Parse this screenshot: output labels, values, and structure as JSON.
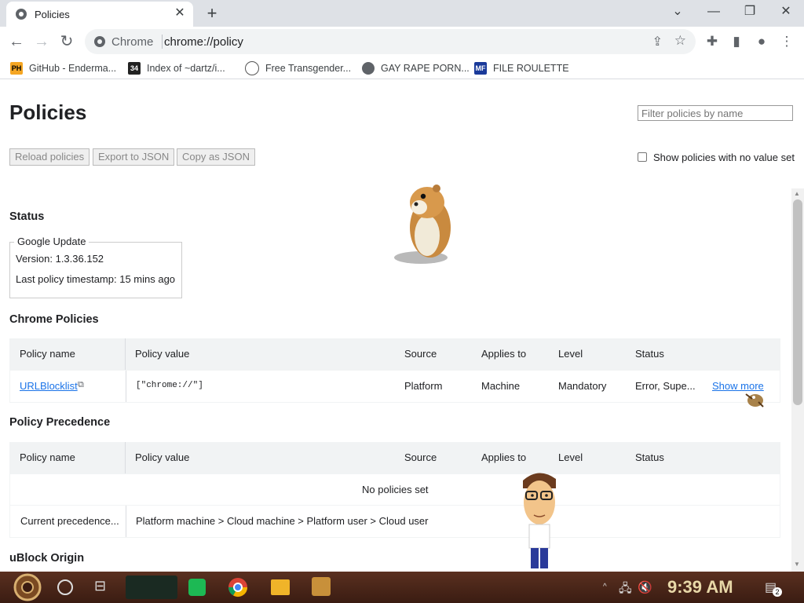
{
  "browser": {
    "tab_title": "Policies",
    "omnibox_chip": "Chrome",
    "url": "chrome://policy"
  },
  "bookmarks": [
    {
      "label": "GitHub - Enderma...",
      "icon_text": "PH",
      "icon_color": "#f5a623"
    },
    {
      "label": "Index of ~dartz/i...",
      "icon_text": "34",
      "icon_color": "#222222"
    },
    {
      "label": "Free Transgender...",
      "icon_text": "",
      "icon_color": "#555555"
    },
    {
      "label": "GAY RAPE PORN...",
      "icon_text": "",
      "icon_color": "#5f6368"
    },
    {
      "label": "FILE ROULETTE",
      "icon_text": "MF",
      "icon_color": "#1a3a9a"
    }
  ],
  "page": {
    "title": "Policies",
    "filter_placeholder": "Filter policies by name",
    "buttons": {
      "reload": "Reload policies",
      "export": "Export to JSON",
      "copy": "Copy as JSON"
    },
    "show_no_value_label": "Show policies with no value set",
    "status": {
      "heading": "Status",
      "legend": "Google Update",
      "version": "Version: 1.3.36.152",
      "timestamp": "Last policy timestamp: 15 mins ago"
    },
    "chrome_policies": {
      "heading": "Chrome Policies",
      "columns": [
        "Policy name",
        "Policy value",
        "Source",
        "Applies to",
        "Level",
        "Status"
      ],
      "rows": [
        {
          "name": "URLBlocklist",
          "value": "[\"chrome://\"]",
          "source": "Platform",
          "applies_to": "Machine",
          "level": "Mandatory",
          "status": "Error, Supe...",
          "action": "Show more"
        }
      ]
    },
    "precedence": {
      "heading": "Policy Precedence",
      "columns": [
        "Policy name",
        "Policy value",
        "Source",
        "Applies to",
        "Level",
        "Status"
      ],
      "empty": "No policies set",
      "current_label": "Current precedence...",
      "current_value": "Platform machine > Cloud machine > Platform user > Cloud user"
    },
    "next_heading": "uBlock Origin"
  },
  "taskbar": {
    "time": "9:39 AM",
    "notification_count": "2"
  },
  "colors": {
    "link": "#1a73e8",
    "tab_strip": "#dee1e6",
    "table_header": "#f1f3f4"
  }
}
